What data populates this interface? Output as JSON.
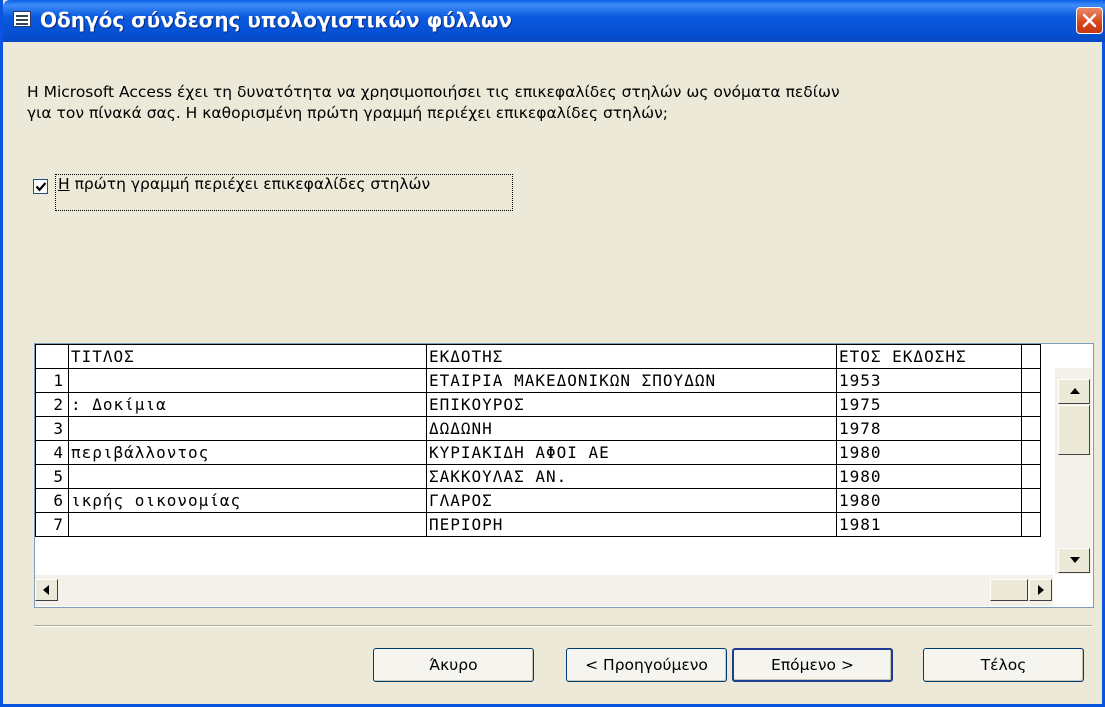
{
  "window": {
    "title": "Οδηγός σύνδεσης υπολογιστικών φύλλων"
  },
  "description": "Η Microsoft Access έχει τη δυνατότητα να χρησιμοποιήσει τις επικεφαλίδες στηλών ως ονόματα πεδίων για τον πίνακά σας. Η καθορισμένη πρώτη γραμμή περιέχει επικεφαλίδες στηλών;",
  "checkbox": {
    "label_mnemonic": "Η",
    "label_rest": " πρώτη γραμμή περιέχει επικεφαλίδες στηλών",
    "checked": true
  },
  "grid": {
    "headers": [
      "ΤΙΤΛΟΣ",
      "ΕΚΔΟΤΗΣ",
      "ΕΤΟΣ ΕΚΔΟΣΗΣ"
    ],
    "rows": [
      {
        "n": "1",
        "title": "",
        "publisher": "ΕΤΑΙΡΙΑ ΜΑΚΕΔΟΝΙΚΩΝ ΣΠΟΥΔΩΝ",
        "year": "1953"
      },
      {
        "n": "2",
        "title": ": Δοκίμια",
        "publisher": "ΕΠΙΚΟΥΡΟΣ",
        "year": "1975"
      },
      {
        "n": "3",
        "title": "",
        "publisher": "ΔΩΔΩΝΗ",
        "year": "1978"
      },
      {
        "n": "4",
        "title": "περιβάλλοντος",
        "publisher": "ΚΥΡΙΑΚΙΔΗ ΑΦΟΙ ΑΕ",
        "year": "1980"
      },
      {
        "n": "5",
        "title": "",
        "publisher": "ΣΑΚΚΟΥΛΑΣ ΑΝ.",
        "year": "1980"
      },
      {
        "n": "6",
        "title": "ικρής οικονομίας",
        "publisher": "ΓΛΑΡΟΣ",
        "year": "1980"
      },
      {
        "n": "7",
        "title": "",
        "publisher": "ΠΕΡΙΟΡΗ",
        "year": "1981"
      }
    ]
  },
  "buttons": {
    "cancel": "Άκυρο",
    "back": "< Προηγούμενο",
    "next": "Επόμενο >",
    "finish": "Τέλος"
  }
}
